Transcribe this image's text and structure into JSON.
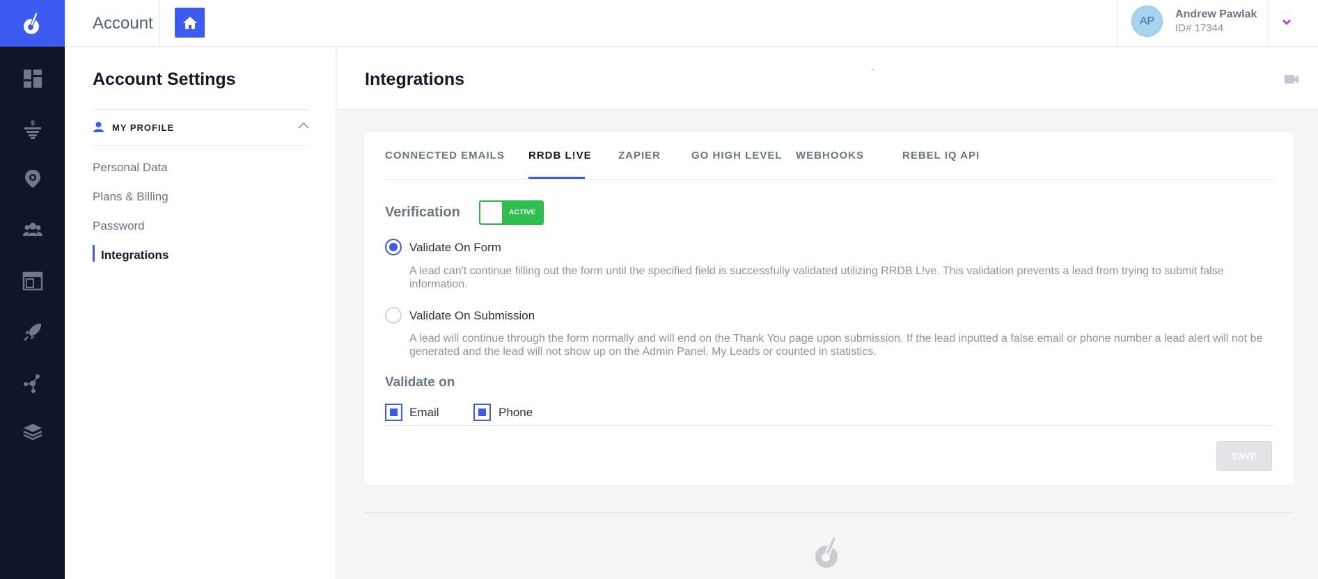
{
  "app": {
    "brand_color": "#3d5af1",
    "rail_color": "#0e1628"
  },
  "rail": {
    "items": [
      "dashboard-icon",
      "funnel-dollar-icon",
      "location-target-icon",
      "users-group-icon",
      "browser-window-icon",
      "rocket-icon",
      "network-nodes-icon",
      "layers-stack-icon"
    ]
  },
  "topbar": {
    "title": "Account",
    "user": {
      "initials": "AP",
      "name": "Andrew Pawlak",
      "id": "ID# 17344"
    }
  },
  "settings": {
    "title": "Account Settings",
    "section": "MY PROFILE",
    "items": [
      {
        "label": "Personal Data"
      },
      {
        "label": "Plans & Billing"
      },
      {
        "label": "Password"
      },
      {
        "label": "Integrations"
      }
    ]
  },
  "main": {
    "title": "Integrations",
    "stray_mark": "`",
    "tabs": [
      {
        "label": "CONNECTED EMAILS"
      },
      {
        "label": "RRDB L!VE"
      },
      {
        "label": "ZAPIER"
      },
      {
        "label": "GO HIGH LEVEL"
      },
      {
        "label": "WEBHOOKS"
      },
      {
        "label": "REBEL IQ API"
      }
    ],
    "active_tab": "RRDB L!VE",
    "verification": {
      "label": "Verification",
      "state": "ACTIVE",
      "on_color": "#2fbf4e"
    },
    "options": [
      {
        "label": "Validate On Form",
        "selected": true,
        "description": "A lead can't continue filling out the form until the specified field is successfully validated utilizing RRDB L!ve. This validation prevents a lead from trying to submit false information."
      },
      {
        "label": "Validate On Submission",
        "selected": false,
        "description": "A lead will continue through the form normally and will end on the Thank You page upon submission. If the lead inputted a false email or phone number a lead alert will not be generated and the lead will not show up on the Admin Panel, My Leads or counted in statistics."
      }
    ],
    "validate_on": {
      "label": "Validate on",
      "email": {
        "label": "Email",
        "checked": true
      },
      "phone": {
        "label": "Phone",
        "checked": true
      }
    },
    "save_label": "SAVE"
  }
}
